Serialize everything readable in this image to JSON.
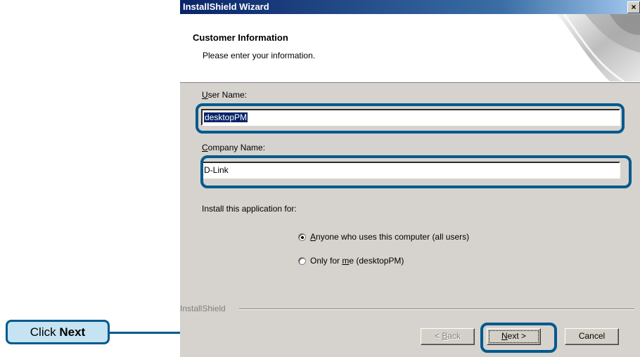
{
  "window": {
    "title": "InstallShield Wizard",
    "close_glyph": "×"
  },
  "header": {
    "title": "Customer Information",
    "subtitle": "Please enter your information."
  },
  "form": {
    "user_name_label_accel": "U",
    "user_name_label_rest": "ser Name:",
    "user_name_value": "desktopPM",
    "company_name_label_accel": "C",
    "company_name_label_rest": "ompany Name:",
    "company_name_value": "D-Link",
    "install_for_label": "Install this application for:",
    "option_all_accel": "A",
    "option_all_rest": "nyone who uses this computer (all users)",
    "option_me_pre": "Only for ",
    "option_me_accel": "m",
    "option_me_post": "e (desktopPM)",
    "selected_option": "all"
  },
  "footer": {
    "brand": "InstallShield",
    "back_pre": "< ",
    "back_accel": "B",
    "back_rest": "ack",
    "next_accel": "N",
    "next_rest": "ext >",
    "cancel_label": "Cancel"
  },
  "callout": {
    "pre": "Click ",
    "bold": "Next"
  },
  "colors": {
    "highlight": "#005a8e",
    "callout_fill": "#c5e3f2",
    "dialog_bg": "#d6d3ce",
    "title_bar": "#0a246a"
  }
}
